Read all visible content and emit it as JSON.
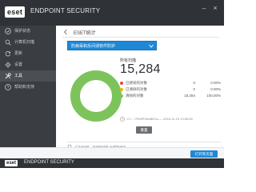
{
  "window": {
    "logo_text": "eset",
    "title": "ENDPOINT SECURITY"
  },
  "sidebar": {
    "items": [
      {
        "label": "保护状态",
        "icon": "check-icon",
        "active": false
      },
      {
        "label": "计算机扫描",
        "icon": "scan-icon",
        "active": false
      },
      {
        "label": "更新",
        "icon": "refresh-icon",
        "active": false
      },
      {
        "label": "设置",
        "icon": "gear-icon",
        "active": false
      },
      {
        "label": "工具",
        "icon": "tools-icon",
        "active": true
      },
      {
        "label": "帮助和支持",
        "icon": "help-icon",
        "active": false
      }
    ],
    "bottom_label": "ENJOY SAFER TECHNOLOGY"
  },
  "main": {
    "section_title": "ESET统计",
    "dropdown_value": "防病毒和反间谍软件防护",
    "stats_title": "所有扫描",
    "total": "15,284",
    "legend": [
      {
        "label": "已感染的对象",
        "count": "0",
        "pct": "0.00%",
        "color": "#e74c3c"
      },
      {
        "label": "已清除的对象",
        "count": "0",
        "pct": "0.00%",
        "color": "#f0b400"
      },
      {
        "label": "清除的对象",
        "count": "15,284",
        "pct": "100.00%",
        "color": "#7dc35b"
      }
    ],
    "info_text": "C:\\…\\TEMP\\Rar$EXa — 2016-11-19 13:06:35",
    "reset_label": "重置",
    "path_text": "C:\\Users\\…\\AppData\\Local\\Temp\\…"
  },
  "footer": {
    "button_label": "打开到页面"
  },
  "bottom_bar": {
    "logo_text": "eset",
    "title": "ENDPOINT SECURITY"
  },
  "colors": {
    "accent": "#1e88d6",
    "donut": "#7dc35b",
    "sidebar": "#3a3d41"
  }
}
